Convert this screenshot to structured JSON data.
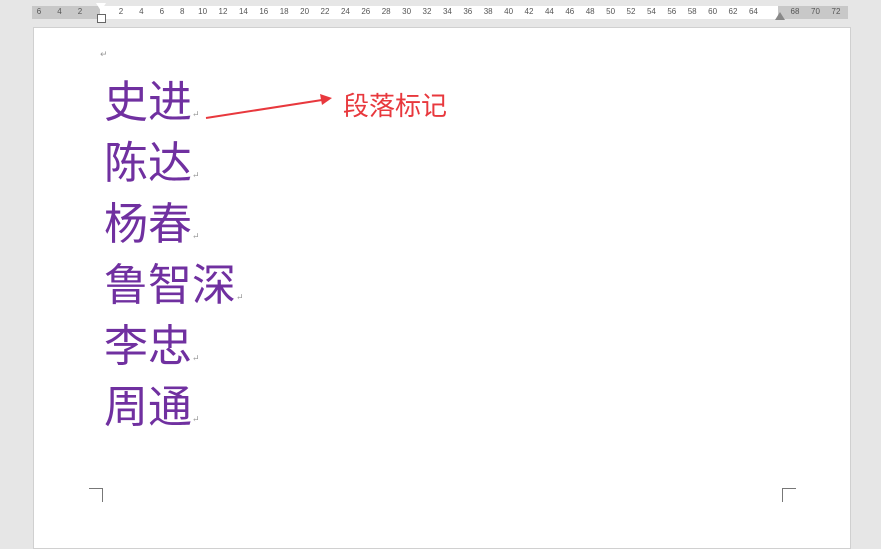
{
  "ruler": {
    "left_ticks": [
      "6",
      "4",
      "2"
    ],
    "ticks": [
      "2",
      "4",
      "6",
      "8",
      "10",
      "12",
      "14",
      "16",
      "18",
      "20",
      "22",
      "24",
      "26",
      "28",
      "30",
      "32",
      "34",
      "36",
      "38",
      "40",
      "42",
      "44",
      "46",
      "48",
      "50",
      "52",
      "54",
      "56",
      "58",
      "60",
      "62",
      "64"
    ],
    "right_ticks": [
      "68",
      "70",
      "72"
    ]
  },
  "document": {
    "empty_para_mark": "↵",
    "lines": [
      "史进",
      "陈达",
      "杨春",
      "鲁智深",
      "李忠",
      "周通"
    ],
    "para_mark": "↵"
  },
  "annotation": {
    "label": "段落标记",
    "color": "#e8383d"
  },
  "colors": {
    "text": "#7030a0"
  }
}
